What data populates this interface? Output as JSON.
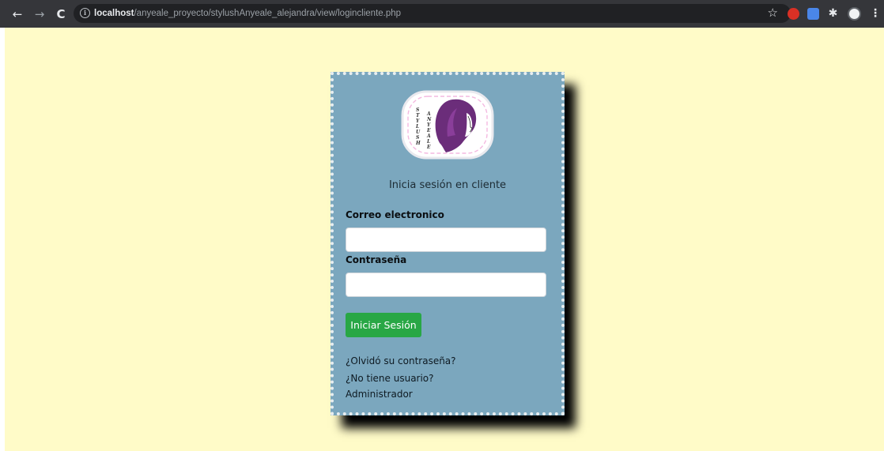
{
  "browser": {
    "url_host": "localhost",
    "url_path": "/anyeale_proyecto/stylushAnyeale_alejandra/view/logincliente.php",
    "icons": {
      "back": "back-arrow-icon",
      "forward": "forward-arrow-icon",
      "reload": "reload-icon",
      "info": "info-icon",
      "star": "bookmark-star-icon",
      "extensions": "puzzle-icon",
      "menu": "kebab-menu-icon"
    }
  },
  "logo": {
    "text_left": "STYLUSH",
    "text_right": "ANYEALE",
    "colors": {
      "hair": "#6b2d7a",
      "frame": "#f4b9e0"
    }
  },
  "login": {
    "subtitle": "Inicia sesión en cliente",
    "email_label": "Correo electronico",
    "email_value": "",
    "password_label": "Contraseña",
    "password_value": "",
    "submit_label": "Iniciar Sesión",
    "forgot_link": "¿Olvidó su contraseña?",
    "no_user_link": "¿No tiene usuario?",
    "admin_link": "Administrador"
  },
  "colors": {
    "page_background": "#fffbc8",
    "card_background": "#7ba7be",
    "button": "#28a745"
  }
}
